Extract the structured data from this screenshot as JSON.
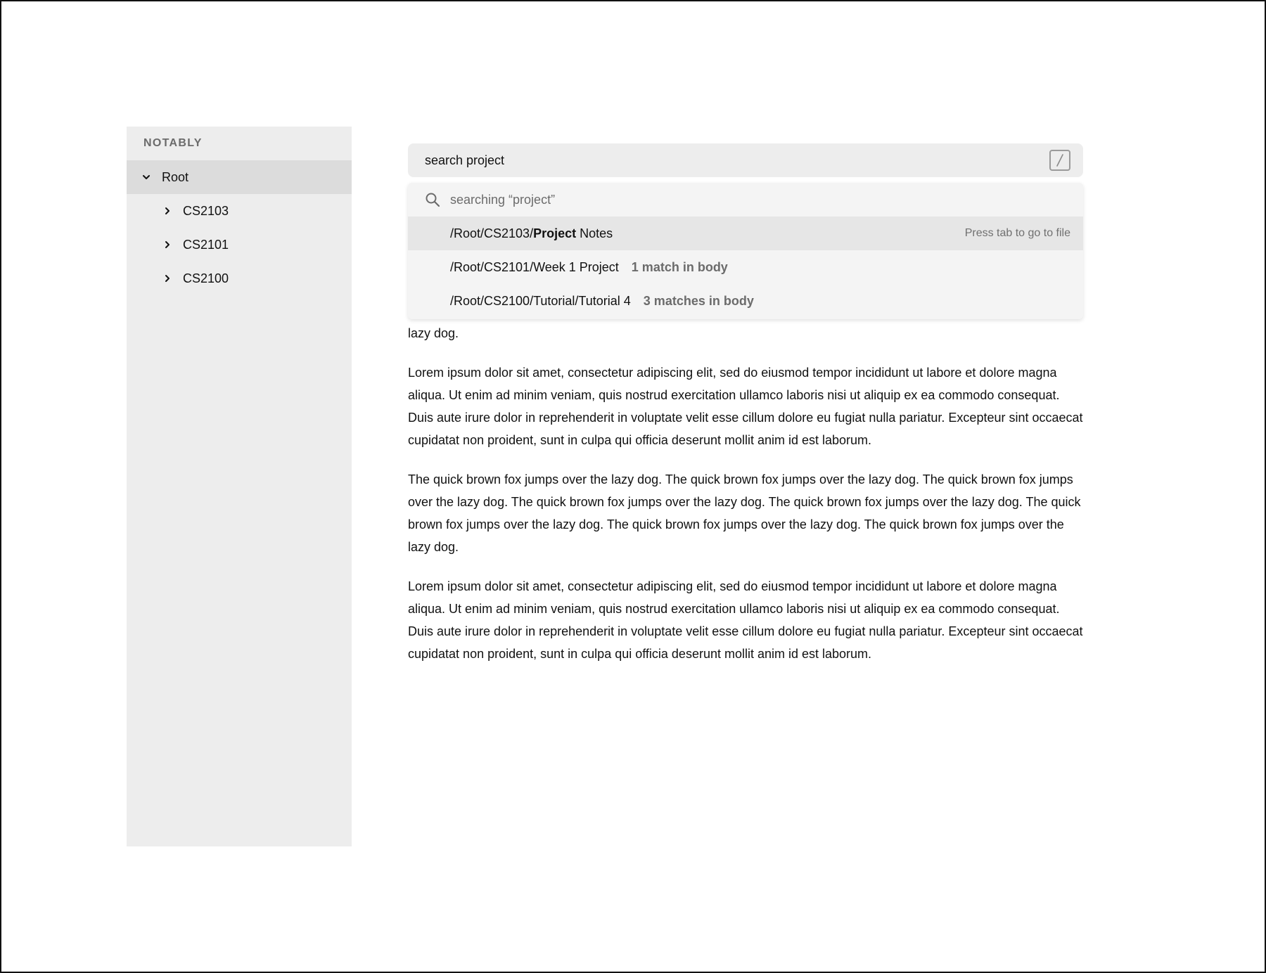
{
  "sidebar": {
    "title": "NOTABLY",
    "root": {
      "label": "Root"
    },
    "items": [
      {
        "label": "CS2103"
      },
      {
        "label": "CS2101"
      },
      {
        "label": "CS2100"
      }
    ]
  },
  "search": {
    "value": "search project",
    "shortcut_key": "/"
  },
  "dropdown": {
    "searching_label": "searching “project”",
    "results": [
      {
        "path_prefix": "/Root/CS2103/",
        "match": "Project",
        "path_suffix": " Notes",
        "hint": "Press tab to go to file"
      },
      {
        "path": "/Root/CS2101/Week 1 Project",
        "meta": "1 match in body"
      },
      {
        "path": "/Root/CS2100/Tutorial/Tutorial 4",
        "meta": "3 matches in body"
      }
    ]
  },
  "content": {
    "paragraphs": [
      "lazy dog.",
      "Lorem ipsum dolor sit amet, consectetur adipiscing elit, sed do eiusmod tempor incididunt ut labore et dolore magna aliqua. Ut enim ad minim veniam, quis nostrud exercitation ullamco laboris nisi ut aliquip ex ea commodo consequat. Duis aute irure dolor in reprehenderit in voluptate velit esse cillum dolore eu fugiat nulla pariatur. Excepteur sint occaecat cupidatat non proident, sunt in culpa qui officia deserunt mollit anim id est laborum.",
      "The quick brown fox jumps over the lazy dog. The quick brown fox jumps over the lazy dog. The quick brown fox jumps over the lazy dog. The quick brown fox jumps over the lazy dog. The quick brown fox jumps over the lazy dog. The quick brown fox jumps over the lazy dog. The quick brown fox jumps over the lazy dog. The quick brown fox jumps over the lazy dog.",
      "Lorem ipsum dolor sit amet, consectetur adipiscing elit, sed do eiusmod tempor incididunt ut labore et dolore magna aliqua. Ut enim ad minim veniam, quis nostrud exercitation ullamco laboris nisi ut aliquip ex ea commodo consequat. Duis aute irure dolor in reprehenderit in voluptate velit esse cillum dolore eu fugiat nulla pariatur. Excepteur sint occaecat cupidatat non proident, sunt in culpa qui officia deserunt mollit anim id est laborum."
    ]
  }
}
